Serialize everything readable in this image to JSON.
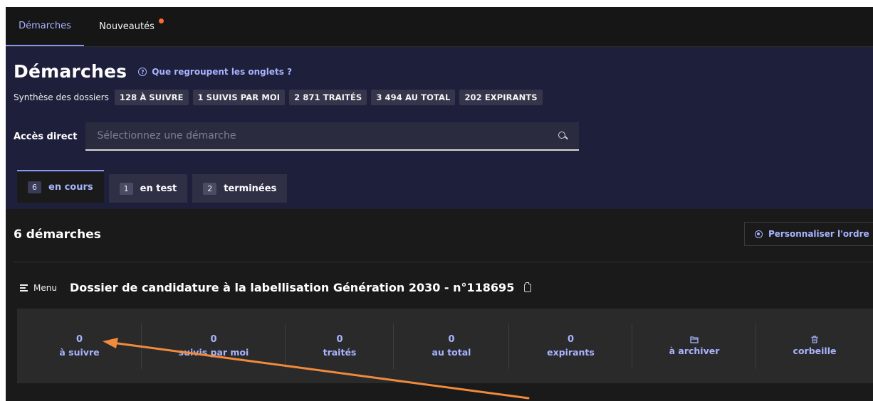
{
  "nav": {
    "items": [
      {
        "label": "Démarches",
        "active": true
      },
      {
        "label": "Nouveautés",
        "notification": true
      }
    ]
  },
  "header": {
    "title": "Démarches",
    "help_link": "Que regroupent les onglets ?",
    "synthesis_label": "Synthèse des dossiers",
    "badges": [
      "128 À SUIVRE",
      "1 SUIVIS PAR MOI",
      "2 871 TRAITÉS",
      "3 494 AU TOTAL",
      "202 EXPIRANTS"
    ],
    "access_label": "Accès direct",
    "access_placeholder": "Sélectionnez une démarche"
  },
  "tabs": [
    {
      "count": "6",
      "label": "en cours",
      "active": true
    },
    {
      "count": "1",
      "label": "en test"
    },
    {
      "count": "2",
      "label": "terminées"
    }
  ],
  "content": {
    "count_title": "6 démarches",
    "customize_button": "Personnaliser l'ordre",
    "menu_label": "Menu",
    "procedure_title": "Dossier de candidature à la labellisation Génération 2030 - n°118695",
    "stats": [
      {
        "value": "0",
        "label": "à suivre"
      },
      {
        "value": "0",
        "label": "suivis par moi"
      },
      {
        "value": "0",
        "label": "traités"
      },
      {
        "value": "0",
        "label": "au total"
      },
      {
        "value": "0",
        "label": "expirants"
      },
      {
        "icon": "folder-icon",
        "label": "à archiver"
      },
      {
        "icon": "trash-icon",
        "label": "corbeille"
      }
    ]
  },
  "colors": {
    "accent": "#a8b4ff",
    "band": "#1e1f3a",
    "background": "#1a1a1a",
    "annotation_arrow": "#f08a3c",
    "notification_dot": "#ff6b2c"
  }
}
